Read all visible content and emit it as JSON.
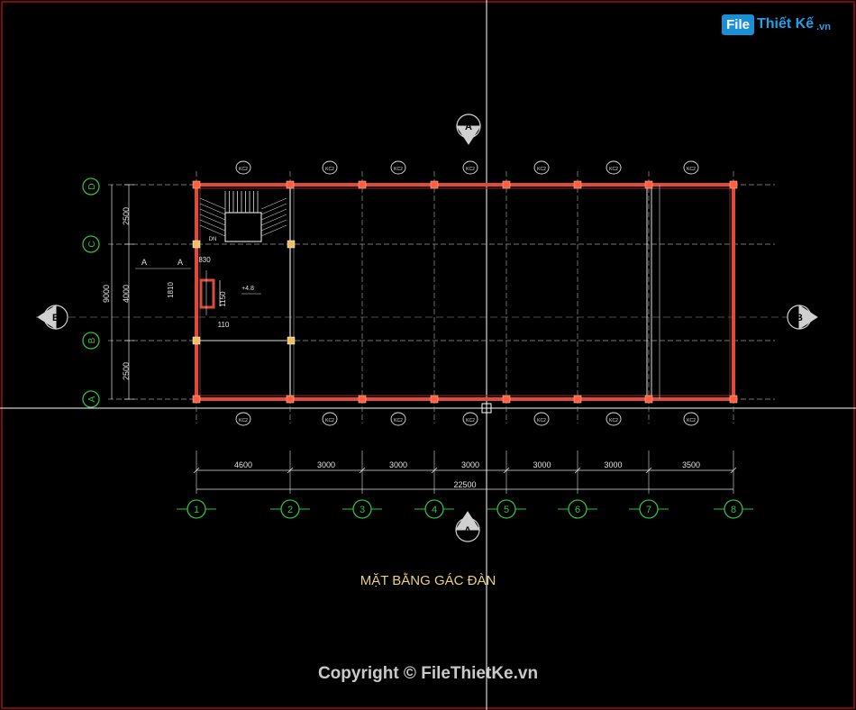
{
  "logo": {
    "brand_box": "File",
    "brand_rest": "Thiết Kế",
    "brand_suffix": ".vn"
  },
  "drawing": {
    "title": "MẶT BẰNG GÁC ĐÀN",
    "copyright": "Copyright © FileThietKe.vn",
    "section_mark_top": "A",
    "section_mark_bottom": "A",
    "section_mark_left": "B",
    "section_mark_right": "B",
    "grid_columns": [
      "1",
      "2",
      "3",
      "4",
      "5",
      "6",
      "7",
      "8"
    ],
    "grid_rows": [
      "D",
      "C",
      "B",
      "A"
    ],
    "column_spacings": [
      "4600",
      "3000",
      "3000",
      "3000",
      "3000",
      "3000",
      "3500"
    ],
    "total_length": "22500",
    "row_spacings": [
      "2500",
      "4000",
      "2500"
    ],
    "total_width": "9000",
    "column_tag": "KC2",
    "stair_dims": [
      "830",
      "1810",
      "1150",
      "110"
    ],
    "level_mark": "+4.8",
    "section_label_left_1": "A",
    "section_label_left_2": "A",
    "stair_label": "DN"
  },
  "colors": {
    "background": "#000000",
    "frame": "#a01010",
    "crosshair": "#ffffff",
    "wall": "#e04a3a",
    "grid_bubble": "#30c040",
    "dimension": "#e0e0e0",
    "title": "#e8d07a"
  }
}
